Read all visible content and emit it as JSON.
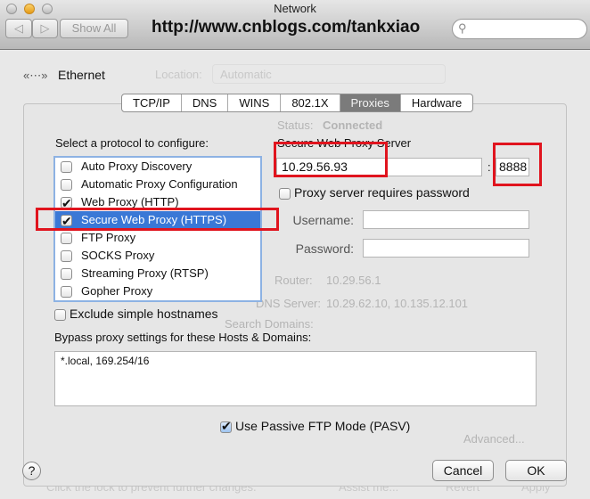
{
  "window": {
    "title": "Network",
    "url_overlay": "http://www.cnblogs.com/tankxiao"
  },
  "toolbar": {
    "show_all": "Show All",
    "search_placeholder": ""
  },
  "background": {
    "service": "Ethernet",
    "location_label": "Location:",
    "location_value": "Automatic",
    "status_label": "Status:",
    "status_value": "Connected",
    "router_label": "Router:",
    "router_value": "10.29.56.1",
    "dns_label": "DNS Server:",
    "dns_value": "10.29.62.10, 10.135.12.101",
    "search_domains_label": "Search Domains:",
    "advanced": "Advanced...",
    "lock_text": "Click the lock to prevent further changes.",
    "assist": "Assist me...",
    "revert": "Revert",
    "apply": "Apply"
  },
  "tabs": [
    {
      "label": "TCP/IP"
    },
    {
      "label": "DNS"
    },
    {
      "label": "WINS"
    },
    {
      "label": "802.1X"
    },
    {
      "label": "Proxies",
      "selected": true
    },
    {
      "label": "Hardware"
    }
  ],
  "protocols": {
    "heading": "Select a protocol to configure:",
    "items": [
      {
        "label": "Auto Proxy Discovery",
        "checked": false
      },
      {
        "label": "Automatic Proxy Configuration",
        "checked": false
      },
      {
        "label": "Web Proxy (HTTP)",
        "checked": true
      },
      {
        "label": "Secure Web Proxy (HTTPS)",
        "checked": true,
        "selected": true
      },
      {
        "label": "FTP Proxy",
        "checked": false
      },
      {
        "label": "SOCKS Proxy",
        "checked": false
      },
      {
        "label": "Streaming Proxy (RTSP)",
        "checked": false
      },
      {
        "label": "Gopher Proxy",
        "checked": false
      }
    ]
  },
  "server": {
    "heading": "Secure Web Proxy Server",
    "host": "10.29.56.93",
    "colon": ":",
    "port": "8888",
    "requires_password": "Proxy server requires password",
    "username_label": "Username:",
    "password_label": "Password:",
    "username": "",
    "password": ""
  },
  "exclude_simple": "Exclude simple hostnames",
  "bypass": {
    "label": "Bypass proxy settings for these Hosts & Domains:",
    "value": "*.local, 169.254/16"
  },
  "passive_ftp": {
    "label": "Use Passive FTP Mode (PASV)",
    "checked": true
  },
  "buttons": {
    "help": "?",
    "cancel": "Cancel",
    "ok": "OK"
  },
  "colors": {
    "selection": "#3a78d6",
    "highlight_box": "#e0141e"
  }
}
